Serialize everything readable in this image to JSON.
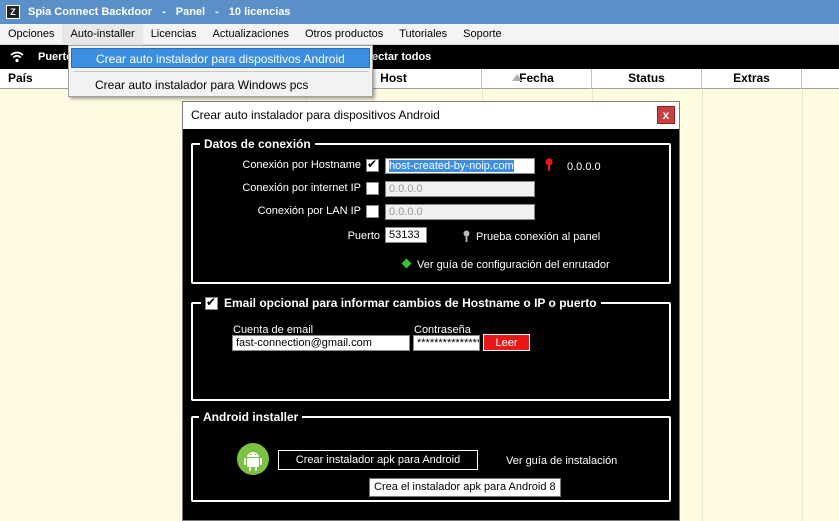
{
  "window": {
    "title_app": "Spia Connect Backdoor",
    "title_sep1": "-",
    "title_panel": "Panel",
    "title_sep2": "-",
    "title_license": "10 licencias"
  },
  "menubar": {
    "items": [
      "Opciones",
      "Auto-installer",
      "Licencias",
      "Actualizaciones",
      "Otros productos",
      "Tutoriales",
      "Soporte"
    ]
  },
  "toolbar": {
    "left_label": "Puerto",
    "right_label": "ectar todos"
  },
  "table": {
    "columns": [
      "País",
      "Host",
      "Fecha",
      "Status",
      "Extras"
    ]
  },
  "dropdown": {
    "items": [
      "Crear auto instalador para dispositivos Android",
      "Crear auto instalador para Windows pcs"
    ]
  },
  "dialog": {
    "title": "Crear auto instalador para dispositivos Android",
    "close_glyph": "x",
    "connection": {
      "legend": "Datos de conexión",
      "hostname_label": "Conexión por Hostname",
      "hostname_value": "host-created-by-noip.com",
      "hostname_ip": "0.0.0.0",
      "internet_label": "Conexión por internet IP",
      "internet_value": "0.0.0.0",
      "lan_label": "Conexión por LAN IP",
      "lan_value": "0.0.0.0",
      "port_label": "Puerto",
      "port_value": "53133",
      "test_link": "Prueba conexión al panel",
      "router_link": "Ver guía de configuración del enrutador"
    },
    "email": {
      "legend": "Email opcional para informar cambios de Hostname o IP o puerto",
      "account_label": "Cuenta de email",
      "account_value": "fast-connection@gmail.com",
      "password_label": "Contraseña",
      "password_value": "****************",
      "read_button": "Leer"
    },
    "android": {
      "legend": "Android installer",
      "create_button": "Crear instalador apk para Android",
      "guide_link": "Ver guía de instalación",
      "tooltip": "Crea el instalador apk para Android 8"
    }
  },
  "colors": {
    "titlebar": "#5b8fc8",
    "menu_highlight": "#3c8fe0",
    "table_bg": "#fffbe0",
    "red_button": "#e81818",
    "android_green": "#7cc142"
  }
}
